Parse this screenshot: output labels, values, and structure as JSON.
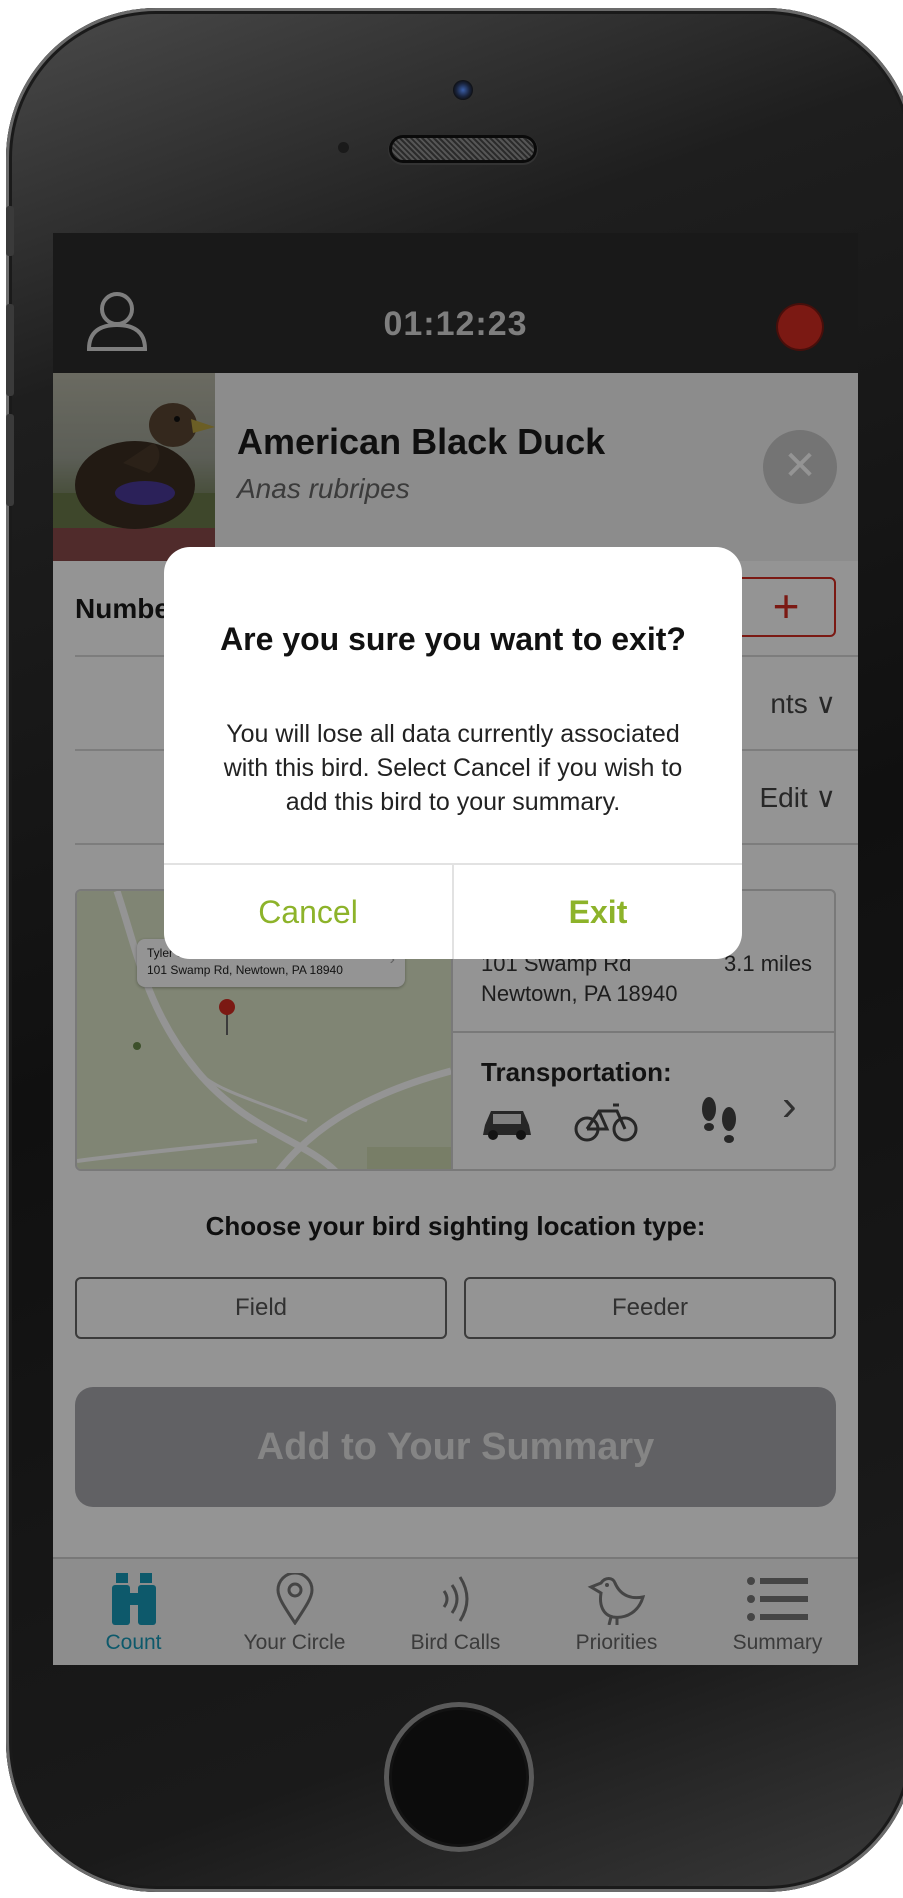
{
  "status_bar": {
    "timer": "01:12:23"
  },
  "bird": {
    "common_name": "American Black Duck",
    "scientific_name": "Anas rubripes"
  },
  "close_symbol": "✕",
  "count_row": {
    "label": "Number",
    "plus_symbol": "+"
  },
  "row2": {
    "right_text": "nts",
    "chevron": "∨"
  },
  "row3": {
    "right_text": "Edit",
    "chevron": "∨"
  },
  "location": {
    "map_popup_title": "Tyler State Park",
    "map_popup_address": "101 Swamp Rd, Newtown, PA 18940",
    "address_line1": "101 Swamp Rd",
    "address_line2": "Newtown, PA 18940",
    "distance": "3.1 miles",
    "transportation_label": "Transportation:",
    "transport_icons": [
      "car-icon",
      "bicycle-icon",
      "footprints-icon"
    ]
  },
  "location_type": {
    "prompt": "Choose your bird sighting location type:",
    "options": [
      "Field",
      "Feeder"
    ]
  },
  "add_button_label": "Add to Your Summary",
  "tabs": [
    {
      "label": "Count",
      "icon": "binoculars-icon",
      "active": true
    },
    {
      "label": "Your Circle",
      "icon": "map-pin-icon",
      "active": false
    },
    {
      "label": "Bird Calls",
      "icon": "sound-waves-icon",
      "active": false
    },
    {
      "label": "Priorities",
      "icon": "bird-icon",
      "active": false
    },
    {
      "label": "Summary",
      "icon": "list-icon",
      "active": false
    }
  ],
  "dialog": {
    "title": "Are you sure you want to exit?",
    "message": "You will lose all data currently associated with this bird. Select Cancel if you wish to add this bird to your summary.",
    "cancel_label": "Cancel",
    "exit_label": "Exit"
  },
  "colors": {
    "accent_green": "#8db32a",
    "record_red": "#d42c22",
    "tab_active": "#1899b8",
    "status_bar_bg": "#2b2b2b"
  }
}
